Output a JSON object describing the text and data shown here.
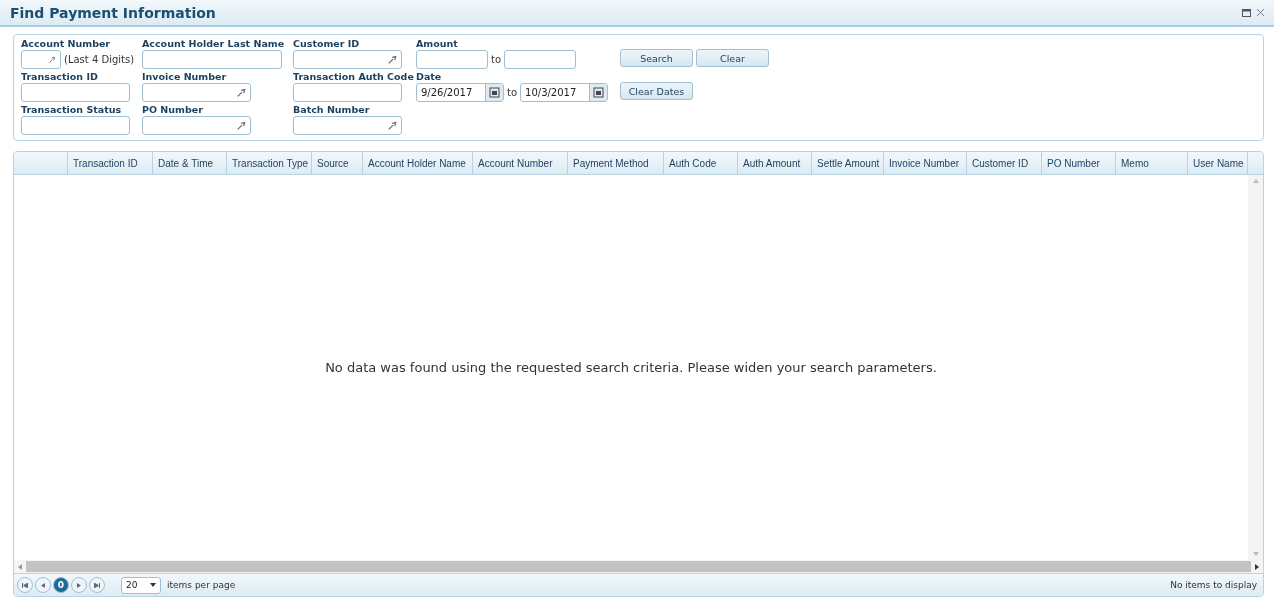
{
  "window": {
    "title": "Find Payment Information"
  },
  "filters": [
    {
      "label": "Account Number",
      "kind": "text",
      "lookup": true,
      "hint": "(Last 4 Digits)"
    },
    {
      "label": "Account Holder Last Name",
      "kind": "text",
      "lookup": false
    },
    {
      "label": "Customer ID",
      "kind": "text",
      "lookup": true
    },
    {
      "label": "Amount",
      "kind": "range",
      "separator": "to"
    },
    {
      "kind": "buttons",
      "buttons": [
        "Search",
        "Clear"
      ]
    },
    {
      "label": "Transaction ID",
      "kind": "text",
      "lookup": false
    },
    {
      "label": "Invoice Number",
      "kind": "text",
      "lookup": true
    },
    {
      "label": "Transaction Auth Code",
      "kind": "text",
      "lookup": false
    },
    {
      "label": "Date",
      "kind": "date",
      "from": "9/26/2017",
      "separator": "to",
      "to": "10/3/2017"
    },
    {
      "kind": "buttons",
      "buttons": [
        "Clear Dates"
      ]
    },
    {
      "label": "Transaction Status",
      "kind": "text",
      "lookup": false
    },
    {
      "label": "PO Number",
      "kind": "text",
      "lookup": true
    },
    {
      "label": "Batch Number",
      "kind": "text",
      "lookup": true
    }
  ],
  "table": {
    "columns": [
      "",
      "Transaction ID",
      "Date & Time",
      "Transaction Type",
      "Source",
      "Account Holder Name",
      "Account Number",
      "Payment Method",
      "Auth Code",
      "Auth Amount",
      "Settle Amount",
      "Invoice Number",
      "Customer ID",
      "PO Number",
      "Memo",
      "User Name"
    ],
    "empty_message": "No data was found using the requested search criteria. Please widen your search parameters."
  },
  "pager": {
    "pages": [
      {
        "label": "0",
        "selected": true
      }
    ],
    "per_page": "20",
    "per_page_label": "items per page",
    "status": "No items to display"
  }
}
